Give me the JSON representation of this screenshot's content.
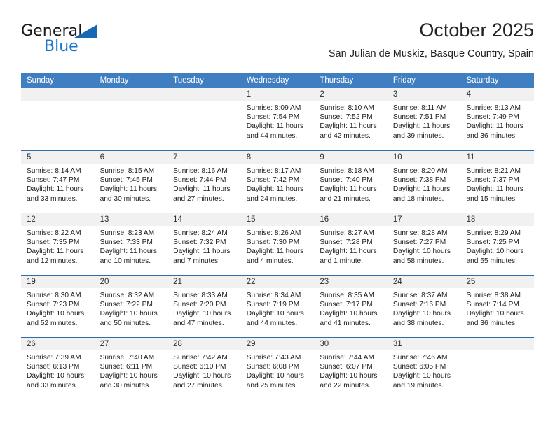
{
  "brand": {
    "word_general": "General",
    "word_blue": "Blue",
    "triangle_icon": "triangle-icon",
    "accent_color": "#1876c8"
  },
  "header": {
    "month_title": "October 2025",
    "location": "San Julian de Muskiz, Basque Country, Spain"
  },
  "calendar": {
    "header_bg": "#3f7fc1",
    "daynum_bg": "#f1f1f1",
    "divider_color": "#2e6da8",
    "weekday_labels": [
      "Sunday",
      "Monday",
      "Tuesday",
      "Wednesday",
      "Thursday",
      "Friday",
      "Saturday"
    ],
    "weeks": [
      [
        {
          "day": "",
          "sunrise": "",
          "sunset": "",
          "daylight": ""
        },
        {
          "day": "",
          "sunrise": "",
          "sunset": "",
          "daylight": ""
        },
        {
          "day": "",
          "sunrise": "",
          "sunset": "",
          "daylight": ""
        },
        {
          "day": "1",
          "sunrise": "Sunrise: 8:09 AM",
          "sunset": "Sunset: 7:54 PM",
          "daylight": "Daylight: 11 hours and 44 minutes."
        },
        {
          "day": "2",
          "sunrise": "Sunrise: 8:10 AM",
          "sunset": "Sunset: 7:52 PM",
          "daylight": "Daylight: 11 hours and 42 minutes."
        },
        {
          "day": "3",
          "sunrise": "Sunrise: 8:11 AM",
          "sunset": "Sunset: 7:51 PM",
          "daylight": "Daylight: 11 hours and 39 minutes."
        },
        {
          "day": "4",
          "sunrise": "Sunrise: 8:13 AM",
          "sunset": "Sunset: 7:49 PM",
          "daylight": "Daylight: 11 hours and 36 minutes."
        }
      ],
      [
        {
          "day": "5",
          "sunrise": "Sunrise: 8:14 AM",
          "sunset": "Sunset: 7:47 PM",
          "daylight": "Daylight: 11 hours and 33 minutes."
        },
        {
          "day": "6",
          "sunrise": "Sunrise: 8:15 AM",
          "sunset": "Sunset: 7:45 PM",
          "daylight": "Daylight: 11 hours and 30 minutes."
        },
        {
          "day": "7",
          "sunrise": "Sunrise: 8:16 AM",
          "sunset": "Sunset: 7:44 PM",
          "daylight": "Daylight: 11 hours and 27 minutes."
        },
        {
          "day": "8",
          "sunrise": "Sunrise: 8:17 AM",
          "sunset": "Sunset: 7:42 PM",
          "daylight": "Daylight: 11 hours and 24 minutes."
        },
        {
          "day": "9",
          "sunrise": "Sunrise: 8:18 AM",
          "sunset": "Sunset: 7:40 PM",
          "daylight": "Daylight: 11 hours and 21 minutes."
        },
        {
          "day": "10",
          "sunrise": "Sunrise: 8:20 AM",
          "sunset": "Sunset: 7:38 PM",
          "daylight": "Daylight: 11 hours and 18 minutes."
        },
        {
          "day": "11",
          "sunrise": "Sunrise: 8:21 AM",
          "sunset": "Sunset: 7:37 PM",
          "daylight": "Daylight: 11 hours and 15 minutes."
        }
      ],
      [
        {
          "day": "12",
          "sunrise": "Sunrise: 8:22 AM",
          "sunset": "Sunset: 7:35 PM",
          "daylight": "Daylight: 11 hours and 12 minutes."
        },
        {
          "day": "13",
          "sunrise": "Sunrise: 8:23 AM",
          "sunset": "Sunset: 7:33 PM",
          "daylight": "Daylight: 11 hours and 10 minutes."
        },
        {
          "day": "14",
          "sunrise": "Sunrise: 8:24 AM",
          "sunset": "Sunset: 7:32 PM",
          "daylight": "Daylight: 11 hours and 7 minutes."
        },
        {
          "day": "15",
          "sunrise": "Sunrise: 8:26 AM",
          "sunset": "Sunset: 7:30 PM",
          "daylight": "Daylight: 11 hours and 4 minutes."
        },
        {
          "day": "16",
          "sunrise": "Sunrise: 8:27 AM",
          "sunset": "Sunset: 7:28 PM",
          "daylight": "Daylight: 11 hours and 1 minute."
        },
        {
          "day": "17",
          "sunrise": "Sunrise: 8:28 AM",
          "sunset": "Sunset: 7:27 PM",
          "daylight": "Daylight: 10 hours and 58 minutes."
        },
        {
          "day": "18",
          "sunrise": "Sunrise: 8:29 AM",
          "sunset": "Sunset: 7:25 PM",
          "daylight": "Daylight: 10 hours and 55 minutes."
        }
      ],
      [
        {
          "day": "19",
          "sunrise": "Sunrise: 8:30 AM",
          "sunset": "Sunset: 7:23 PM",
          "daylight": "Daylight: 10 hours and 52 minutes."
        },
        {
          "day": "20",
          "sunrise": "Sunrise: 8:32 AM",
          "sunset": "Sunset: 7:22 PM",
          "daylight": "Daylight: 10 hours and 50 minutes."
        },
        {
          "day": "21",
          "sunrise": "Sunrise: 8:33 AM",
          "sunset": "Sunset: 7:20 PM",
          "daylight": "Daylight: 10 hours and 47 minutes."
        },
        {
          "day": "22",
          "sunrise": "Sunrise: 8:34 AM",
          "sunset": "Sunset: 7:19 PM",
          "daylight": "Daylight: 10 hours and 44 minutes."
        },
        {
          "day": "23",
          "sunrise": "Sunrise: 8:35 AM",
          "sunset": "Sunset: 7:17 PM",
          "daylight": "Daylight: 10 hours and 41 minutes."
        },
        {
          "day": "24",
          "sunrise": "Sunrise: 8:37 AM",
          "sunset": "Sunset: 7:16 PM",
          "daylight": "Daylight: 10 hours and 38 minutes."
        },
        {
          "day": "25",
          "sunrise": "Sunrise: 8:38 AM",
          "sunset": "Sunset: 7:14 PM",
          "daylight": "Daylight: 10 hours and 36 minutes."
        }
      ],
      [
        {
          "day": "26",
          "sunrise": "Sunrise: 7:39 AM",
          "sunset": "Sunset: 6:13 PM",
          "daylight": "Daylight: 10 hours and 33 minutes."
        },
        {
          "day": "27",
          "sunrise": "Sunrise: 7:40 AM",
          "sunset": "Sunset: 6:11 PM",
          "daylight": "Daylight: 10 hours and 30 minutes."
        },
        {
          "day": "28",
          "sunrise": "Sunrise: 7:42 AM",
          "sunset": "Sunset: 6:10 PM",
          "daylight": "Daylight: 10 hours and 27 minutes."
        },
        {
          "day": "29",
          "sunrise": "Sunrise: 7:43 AM",
          "sunset": "Sunset: 6:08 PM",
          "daylight": "Daylight: 10 hours and 25 minutes."
        },
        {
          "day": "30",
          "sunrise": "Sunrise: 7:44 AM",
          "sunset": "Sunset: 6:07 PM",
          "daylight": "Daylight: 10 hours and 22 minutes."
        },
        {
          "day": "31",
          "sunrise": "Sunrise: 7:46 AM",
          "sunset": "Sunset: 6:05 PM",
          "daylight": "Daylight: 10 hours and 19 minutes."
        },
        {
          "day": "",
          "sunrise": "",
          "sunset": "",
          "daylight": ""
        }
      ]
    ]
  }
}
